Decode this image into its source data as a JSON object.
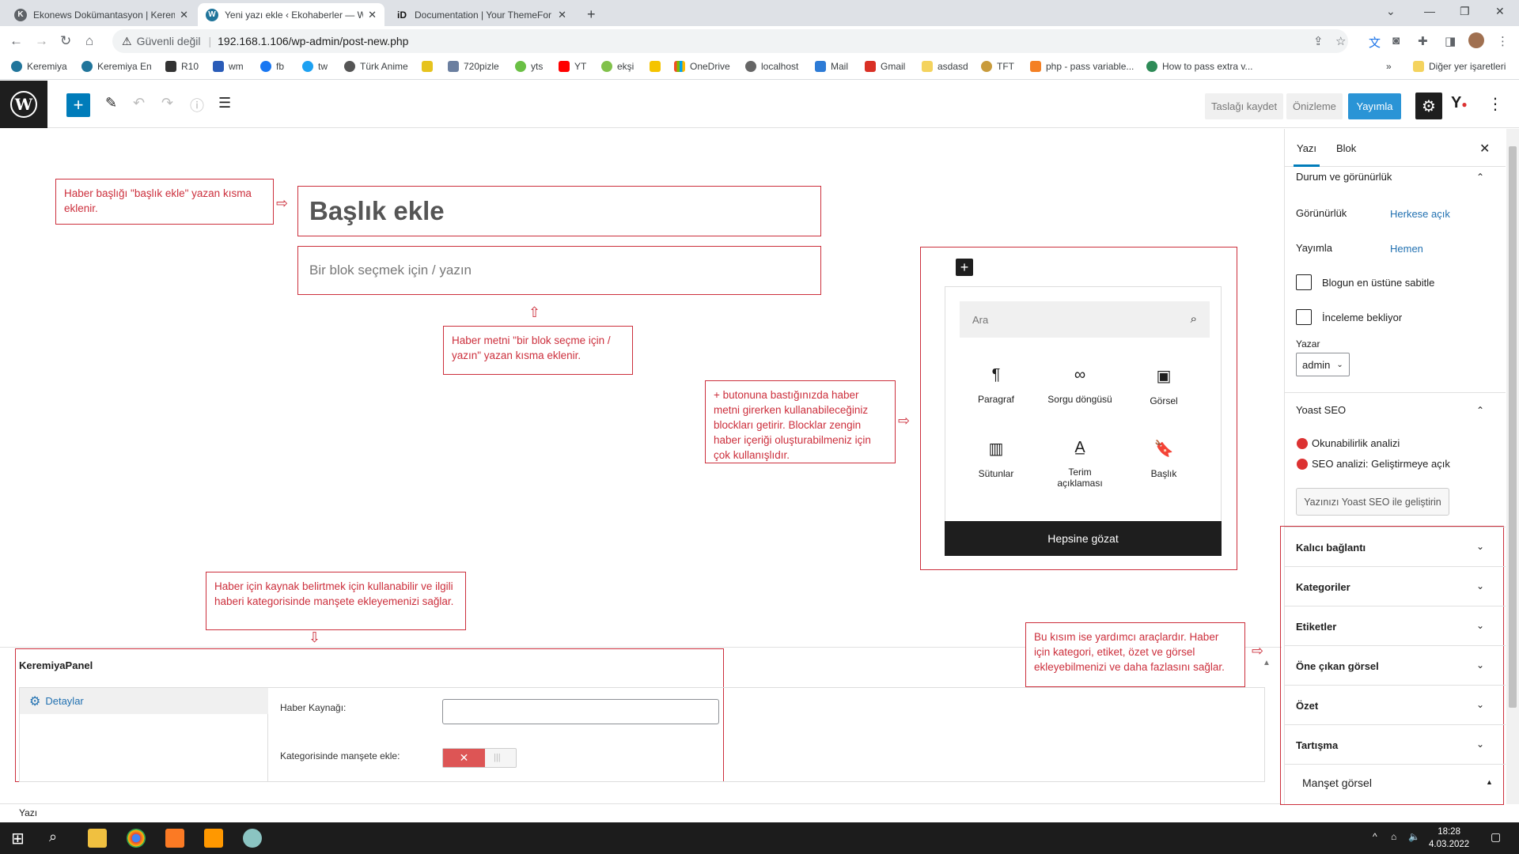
{
  "browser": {
    "tabs": [
      {
        "label": "Ekonews Dokümantasyon | Kerem",
        "icon": "K"
      },
      {
        "label": "Yeni yazı ekle ‹ Ekohaberler — W",
        "icon": "W"
      },
      {
        "label": "Documentation | Your ThemeFor",
        "icon": "iD"
      }
    ],
    "new_tab": "+",
    "address": {
      "security": "Güvenli değil",
      "url": "192.168.1.106/wp-admin/post-new.php"
    },
    "bookmarks": [
      "Keremiya",
      "Keremiya En",
      "R10",
      "wm",
      "fb",
      "tw",
      "Türk Anime",
      "720pizle",
      "yts",
      "YT",
      "ekşi",
      "OneDrive",
      "localhost",
      "Mail",
      "Gmail",
      "asdasd",
      "TFT",
      "php - pass variable...",
      "How to pass extra v..."
    ],
    "bookmarks_more": "»",
    "other_bookmarks": "Diğer yer işaretleri"
  },
  "header": {
    "save_draft": "Taslağı kaydet",
    "preview": "Önizleme",
    "publish": "Yayımla"
  },
  "editor": {
    "title_placeholder": "Başlık ekle",
    "block_placeholder": "Bir blok seçmek için / yazın",
    "notes": {
      "title": "Haber başlığı \"başlık ekle\" yazan kısma eklenir.",
      "block": "Haber metni \"bir blok seçme için / yazın\" yazan kısma eklenir.",
      "inserter": "+ butonuna bastığınızda haber metni girerken kullanabileceğiniz blockları getirir. Blocklar zengin haber içeriği oluşturabilmeniz için çok kullanışlıdır.",
      "meta": "Haber için kaynak belirtmek için kullanabilir ve ilgili haberi kategorisinde manşete ekleyemenizi sağlar.",
      "sidebar": "Bu kısım ise yardımcı araçlardır. Haber için kategori, etiket, özet ve görsel ekleyebilmenizi ve daha fazlasını sağlar."
    }
  },
  "inserter": {
    "search_placeholder": "Ara",
    "blocks": [
      {
        "label": "Paragraf",
        "icon": "¶"
      },
      {
        "label": "Sorgu döngüsü",
        "icon": "∞"
      },
      {
        "label": "Görsel",
        "icon": "▣"
      },
      {
        "label": "Sütunlar",
        "icon": "▥"
      },
      {
        "label": "Terim açıklaması",
        "icon": "A̲"
      },
      {
        "label": "Başlık",
        "icon": "🔖"
      }
    ],
    "browse_all": "Hepsine gözat"
  },
  "meta_panel": {
    "title": "KeremiyaPanel",
    "tab": "Detaylar",
    "source_label": "Haber Kaynağı:",
    "source_value": "",
    "manset_label": "Kategorisinde manşete ekle:",
    "toggle_off_symbol": "✕",
    "toggle_handle": "|||"
  },
  "status_bar": {
    "label": "Yazı"
  },
  "sidebar": {
    "tab_post": "Yazı",
    "tab_block": "Blok",
    "status_section": "Durum ve görünürlük",
    "visibility_label": "Görünürlük",
    "visibility_value": "Herkese açık",
    "publish_label": "Yayımla",
    "publish_value": "Hemen",
    "sticky_label": "Blogun en üstüne sabitle",
    "pending_label": "İnceleme bekliyor",
    "author_label": "Yazar",
    "author_value": "admin",
    "yoast_section": "Yoast SEO",
    "readability": "Okunabilirlik analizi",
    "seo_label": "SEO analizi:",
    "seo_value": "Geliştirmeye açık",
    "yoast_button": "Yazınızı Yoast SEO ile geliştirin",
    "panels": [
      "Kalıcı bağlantı",
      "Kategoriler",
      "Etiketler",
      "Öne çıkan görsel",
      "Özet",
      "Tartışma"
    ],
    "manset_panel": "Manşet görsel"
  },
  "taskbar": {
    "time": "18:28",
    "date": "4.03.2022"
  },
  "colors": {
    "accent": "#007cba",
    "annotation": "#cc2f3c",
    "publish": "#2a94d6"
  }
}
